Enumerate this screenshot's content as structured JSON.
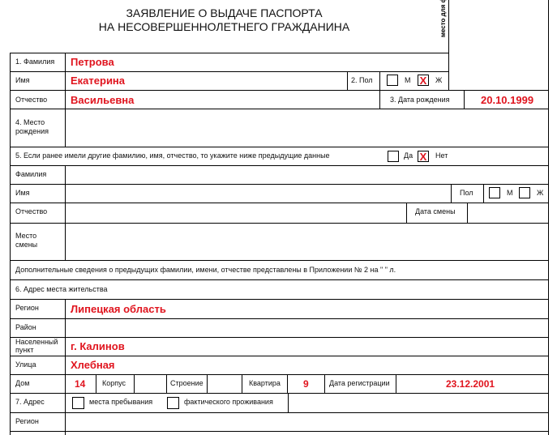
{
  "header": {
    "title_line1": "ЗАЯВЛЕНИЕ О ВЫДАЧЕ ПАСПОРТА",
    "title_line2": "НА НЕСОВЕРШЕННОЛЕТНЕГО ГРАЖДАНИНА",
    "photo_placeholder": "место для ф"
  },
  "colors": {
    "filled_value": "#e0141e",
    "lines": "#000000"
  },
  "section1": {
    "surname_label": "1. Фамилия",
    "surname_value": "Петрова",
    "name_label": "Имя",
    "name_value": "Екатерина",
    "patronymic_label": "Отчество",
    "patronymic_value": "Васильевна",
    "sex_label": "2. Пол",
    "sex_m_label": "М",
    "sex_m_mark": "",
    "sex_f_label": "Ж",
    "sex_f_mark": "X",
    "birthdate_label": "3. Дата рождения",
    "birthdate_value": "20.10.1999",
    "birthplace_label_1": "4. Место",
    "birthplace_label_2": "рождения",
    "birthplace_value": ""
  },
  "section5": {
    "question": "5. Если ранее имели другие фамилию, имя, отчество, то укажите ниже предыдущие данные",
    "yes_label": "Да",
    "yes_mark": "",
    "no_label": "Нет",
    "no_mark": "X",
    "prev_surname_label": "Фамилия",
    "prev_name_label": "Имя",
    "prev_sex_label": "Пол",
    "prev_sex_m_label": "М",
    "prev_sex_f_label": "Ж",
    "prev_patronymic_label": "Отчество",
    "change_date_label": "Дата смены",
    "change_place_label_1": "Место",
    "change_place_label_2": "смены",
    "additional_info": "Дополнительные сведения о предыдущих фамилии, имени, отчестве представлены в Приложении № 2 на \"         \" л."
  },
  "section6": {
    "title": "6. Адрес места жительства",
    "region_label": "Регион",
    "region_value": "Липецкая область",
    "district_label": "Район",
    "district_value": "",
    "locality_label_1": "Населенный",
    "locality_label_2": "пункт",
    "locality_value": "г. Калинов",
    "street_label": "Улица",
    "street_value": "Хлебная",
    "house_label": "Дом",
    "house_value": "14",
    "building_label": "Корпус",
    "building_value": "",
    "structure_label": "Строение",
    "structure_value": "",
    "apartment_label": "Квартира",
    "apartment_value": "9",
    "reg_date_label": "Дата регистрации",
    "reg_date_value": "23.12.2001"
  },
  "section7": {
    "title": "7. Адрес",
    "stay_label": "места пребывания",
    "actual_label": "фактического проживания",
    "region_label": "Регион"
  }
}
